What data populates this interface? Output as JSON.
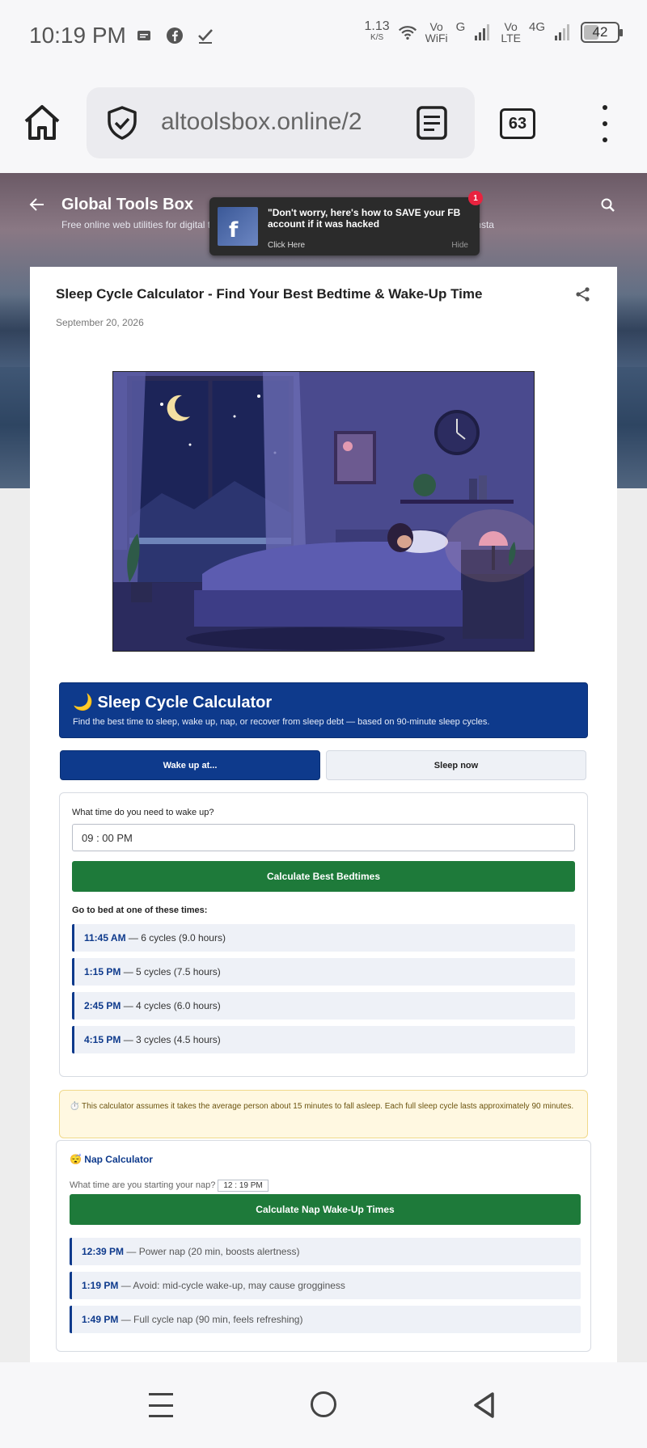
{
  "status_bar": {
    "time": "10:19 PM",
    "net_speed_value": "1.13",
    "net_speed_unit": "K/S",
    "vo_wifi_1": "Vo",
    "vo_wifi_2": "WiFi",
    "g_label": "G",
    "vo_lte_1": "Vo",
    "vo_lte_2": "LTE",
    "net_4g": "4G",
    "battery": "42"
  },
  "browser": {
    "url": "altoolsbox.online/2",
    "tab_count": "63"
  },
  "site": {
    "title": "Global Tools Box",
    "description": "Free online web utilities for digital tasks, calculate loans, download media, and optimize content insta"
  },
  "notification": {
    "text": "\"Don't worry, here's how to SAVE your FB account if it was hacked",
    "click": "Click Here",
    "hide": "Hide",
    "badge": "1"
  },
  "post": {
    "title": "Sleep Cycle Calculator - Find Your Best Bedtime & Wake-Up Time",
    "date": "September 20, 2026"
  },
  "calculator": {
    "title": "🌙 Sleep Cycle Calculator",
    "subtitle": "Find the best time to sleep, wake up, nap, or recover from sleep debt — based on 90-minute sleep cycles.",
    "tabs": [
      "Wake up at...",
      "Sleep now"
    ],
    "field_label": "What time do you need to wake up?",
    "time_value": "09 : 00  PM",
    "button": "Calculate Best Bedtimes",
    "results_label": "Go to bed at one of these times:",
    "results": [
      {
        "time": "11:45 AM",
        "desc": " — 6 cycles (9.0 hours)"
      },
      {
        "time": "1:15 PM",
        "desc": " — 5 cycles (7.5 hours)"
      },
      {
        "time": "2:45 PM",
        "desc": " — 4 cycles (6.0 hours)"
      },
      {
        "time": "4:15 PM",
        "desc": " — 3 cycles (4.5 hours)"
      }
    ],
    "note": "⏱️ This calculator assumes it takes the average person about 15 minutes to fall asleep. Each full sleep cycle lasts approximately 90 minutes."
  },
  "nap": {
    "title": "😴 Nap Calculator",
    "question": "What time are you starting your nap?",
    "time_value": "12 : 19  PM",
    "button": "Calculate Nap Wake-Up Times",
    "results": [
      {
        "time": "12:39 PM",
        "desc": " — Power nap (20 min, boosts alertness)"
      },
      {
        "time": "1:19 PM",
        "desc": " — Avoid: mid-cycle wake-up, may cause grogginess"
      },
      {
        "time": "1:49 PM",
        "desc": " — Full cycle nap (90 min, feels refreshing)"
      }
    ]
  },
  "colors": {
    "primary": "#0e3a8c",
    "button_green": "#1e7a3a",
    "note_bg": "#fff8e1"
  }
}
